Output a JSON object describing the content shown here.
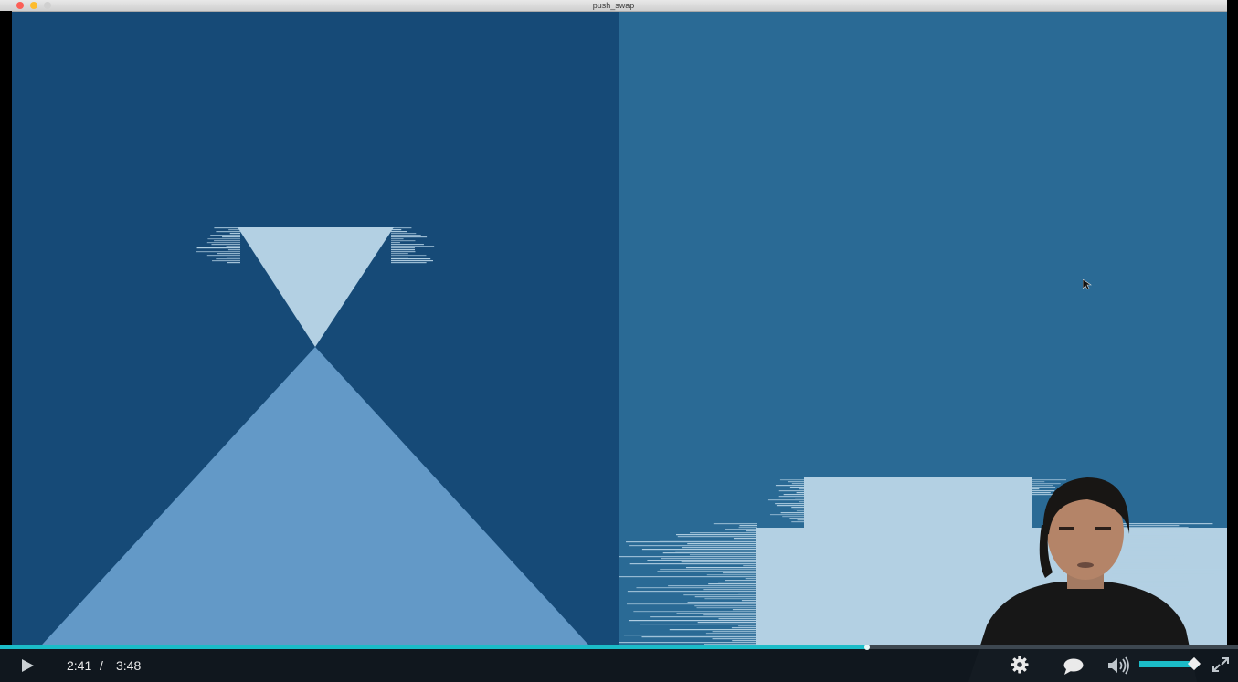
{
  "window": {
    "title": "push_swap"
  },
  "player": {
    "current_time": "2:41",
    "separator": "/",
    "duration": "3:48",
    "progress": 0.7,
    "volume": 0.92
  },
  "icons": {
    "play": "play-icon",
    "settings": "gear-icon",
    "captions": "speech-bubble-icon",
    "volume": "speaker-icon",
    "fullscreen": "expand-icon"
  },
  "colors": {
    "stack_a_bg": "#164a77",
    "stack_b_bg": "#2a6a95",
    "bar_light": "#b3d0e3",
    "bar_mid": "#6399c7",
    "accent": "#1bbcc8"
  }
}
